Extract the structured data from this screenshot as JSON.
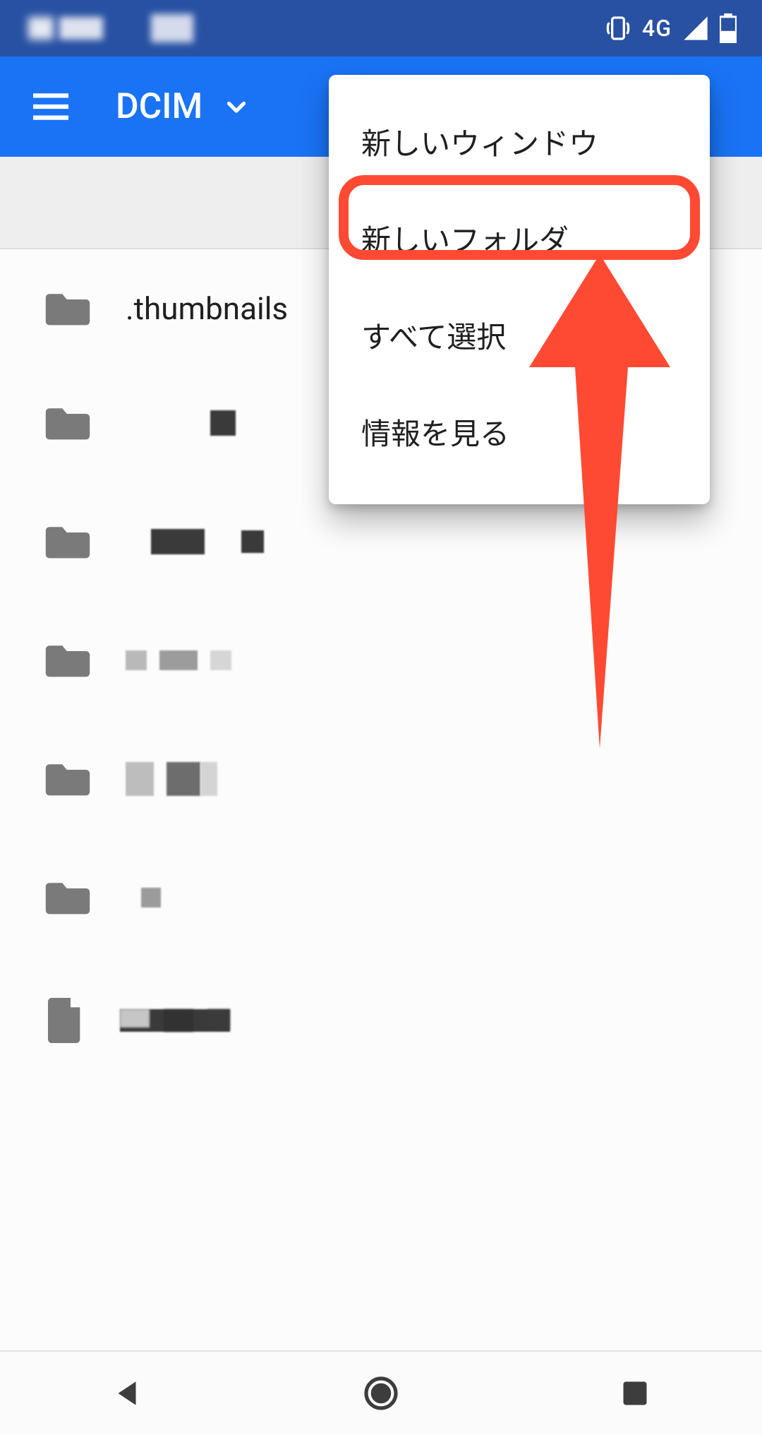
{
  "status_bar": {
    "network_label": "4G"
  },
  "app_bar": {
    "title": "DCIM"
  },
  "popup_menu": {
    "items": [
      {
        "label": "新しいウィンドウ"
      },
      {
        "label": "新しいフォルダ"
      },
      {
        "label": "すべて選択"
      },
      {
        "label": "情報を見る"
      }
    ]
  },
  "file_list": {
    "items": [
      {
        "type": "folder",
        "name": ".thumbnails"
      },
      {
        "type": "folder",
        "name": ""
      },
      {
        "type": "folder",
        "name": ""
      },
      {
        "type": "folder",
        "name": ""
      },
      {
        "type": "folder",
        "name": ""
      },
      {
        "type": "folder",
        "name": ""
      },
      {
        "type": "file",
        "name": ""
      }
    ]
  }
}
